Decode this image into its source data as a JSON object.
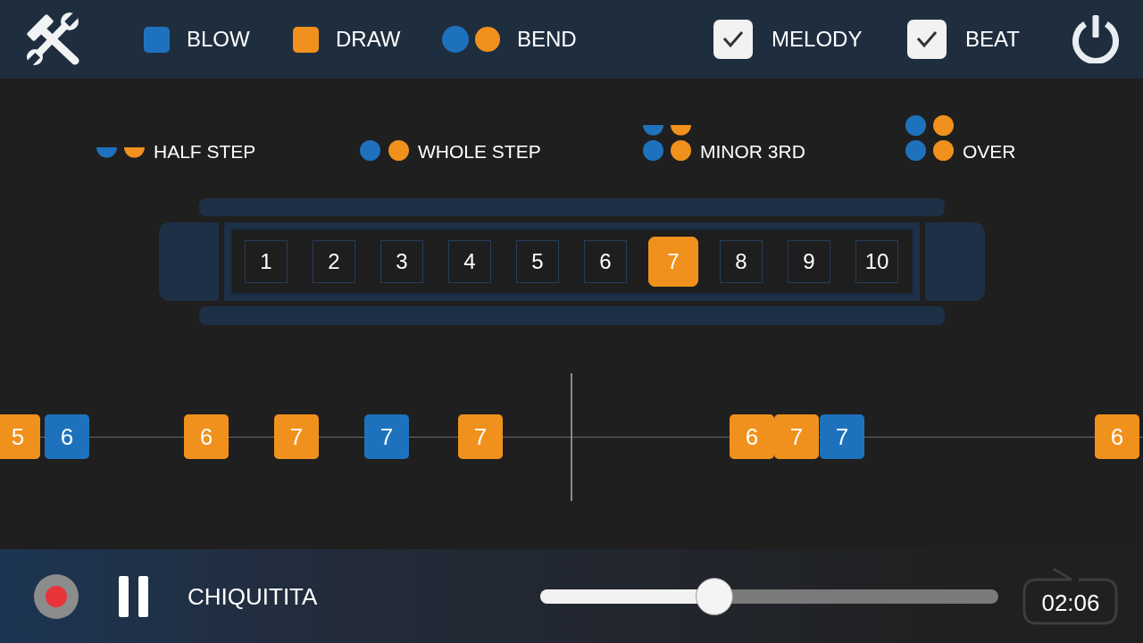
{
  "toolbar": {
    "legend": [
      {
        "kind": "blow",
        "label": "BLOW"
      },
      {
        "kind": "draw",
        "label": "DRAW"
      },
      {
        "kind": "bend",
        "label": "BEND"
      }
    ],
    "toggles": [
      {
        "label": "MELODY",
        "checked": true
      },
      {
        "label": "BEAT",
        "checked": true
      }
    ]
  },
  "bend_legend": [
    {
      "kind": "half",
      "label": "HALF STEP"
    },
    {
      "kind": "whole",
      "label": "WHOLE STEP"
    },
    {
      "kind": "minor3",
      "label": "MINOR 3RD"
    },
    {
      "kind": "over",
      "label": "OVER"
    }
  ],
  "harmonica": {
    "holes": [
      {
        "label": "1",
        "selected": false
      },
      {
        "label": "2",
        "selected": false
      },
      {
        "label": "3",
        "selected": false
      },
      {
        "label": "4",
        "selected": false
      },
      {
        "label": "5",
        "selected": false
      },
      {
        "label": "6",
        "selected": false
      },
      {
        "label": "7",
        "selected": true
      },
      {
        "label": "8",
        "selected": false
      },
      {
        "label": "9",
        "selected": false
      },
      {
        "label": "10",
        "selected": false
      }
    ]
  },
  "timeline": {
    "notes": [
      {
        "hole": "5",
        "kind": "draw"
      },
      {
        "hole": "6",
        "kind": "blow"
      },
      {
        "hole": "6",
        "kind": "draw"
      },
      {
        "hole": "7",
        "kind": "draw"
      },
      {
        "hole": "7",
        "kind": "blow"
      },
      {
        "hole": "7",
        "kind": "draw"
      },
      {
        "hole": "6",
        "kind": "draw"
      },
      {
        "hole": "7",
        "kind": "draw"
      },
      {
        "hole": "7",
        "kind": "blow"
      },
      {
        "hole": "6",
        "kind": "draw"
      }
    ]
  },
  "player": {
    "playing": true,
    "title": "CHIQUITITA",
    "level": 0.37,
    "time": "02:06"
  }
}
